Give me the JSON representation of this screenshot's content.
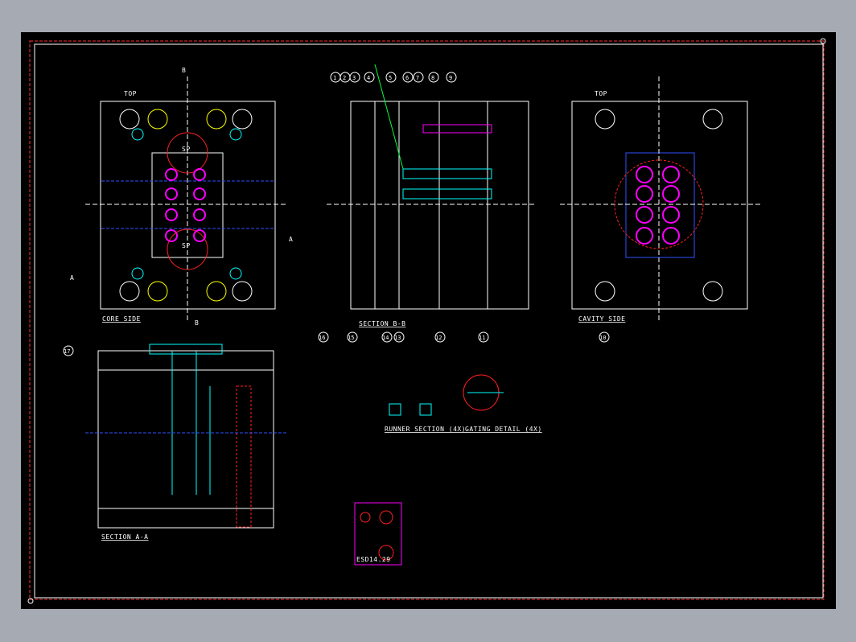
{
  "colors": {
    "background": "#000000",
    "frame": "#a6aab2",
    "border_red": "#ff3030",
    "white": "#ffffff",
    "cyan": "#00ffff",
    "red": "#ff2020",
    "yellow": "#ffff00",
    "green": "#00ff40",
    "magenta": "#ff00ff",
    "blue": "#3050ff"
  },
  "views": {
    "core_side": {
      "title": "CORE SIDE",
      "top_label": "TOP",
      "sp_label": "SP"
    },
    "section_b": {
      "title": "SECTION B-B"
    },
    "cavity_side": {
      "title": "CAVITY SIDE",
      "top_label": "TOP"
    },
    "section_a": {
      "title": "SECTION A-A"
    },
    "runner": {
      "title": "RUNNER SECTION (4X)"
    },
    "gating": {
      "title": "GATING DETAIL (4X)"
    },
    "part": {
      "label": "ESD14.29"
    }
  },
  "markers": {
    "section_a_top": "A",
    "section_a_bottom": "A",
    "section_b_top": "B",
    "section_b_bottom": "B"
  },
  "balloons": [
    "1",
    "2",
    "3",
    "4",
    "5",
    "6",
    "7",
    "8",
    "9",
    "10",
    "11",
    "12",
    "13",
    "14",
    "15",
    "16",
    "17"
  ]
}
